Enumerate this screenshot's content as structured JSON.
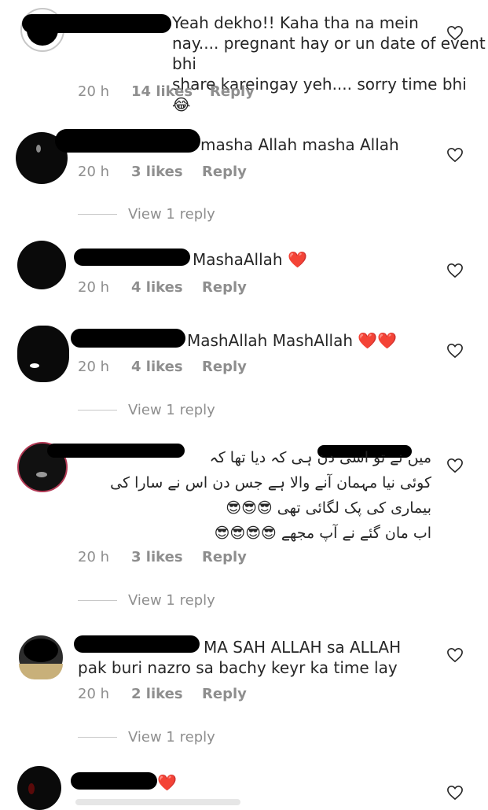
{
  "comments": [
    {
      "text": "Yeah dekho!! Kaha tha na mein\nnay.... pregnant hay or un date of event bhi\nshare kareingay yeh.... sorry time bhi 😂",
      "time": "20 h",
      "likes": "14 likes",
      "reply": "Reply"
    },
    {
      "text": "masha Allah masha Allah",
      "time": "20 h",
      "likes": "3 likes",
      "reply": "Reply",
      "view_replies": "View 1 reply"
    },
    {
      "text": "MashaAllah ❤️",
      "time": "20 h",
      "likes": "4 likes",
      "reply": "Reply"
    },
    {
      "text": "MashAllah MashAllah ❤️❤️",
      "time": "20 h",
      "likes": "4 likes",
      "reply": "Reply",
      "view_replies": "View 1 reply"
    },
    {
      "text_rtl": [
        "میں نے تو اسی دن ہی کہ دیا تھا کہ",
        "کوئی نیا مہمان آنے والا ہے جس دن اس نے سارا کی",
        "بیماری کی پک لگائی تھی 😎😎😎",
        "اب مان گئے نے آپ مجھے 😎😎😎😎"
      ],
      "time": "20 h",
      "likes": "3 likes",
      "reply": "Reply",
      "view_replies": "View 1 reply"
    },
    {
      "text": "MA SAH ALLAH sa ALLAH\npak buri nazro sa bachy keyr ka time lay",
      "time": "20 h",
      "likes": "2 likes",
      "reply": "Reply",
      "view_replies": "View 1 reply"
    },
    {
      "text": "❤️",
      "time": "",
      "likes": "",
      "reply": ""
    }
  ],
  "icons": {
    "like": "heart-outline-icon"
  },
  "colors": {
    "text": "#262626",
    "muted": "#8e8e8e",
    "heart_red": "#ed2e3b"
  }
}
